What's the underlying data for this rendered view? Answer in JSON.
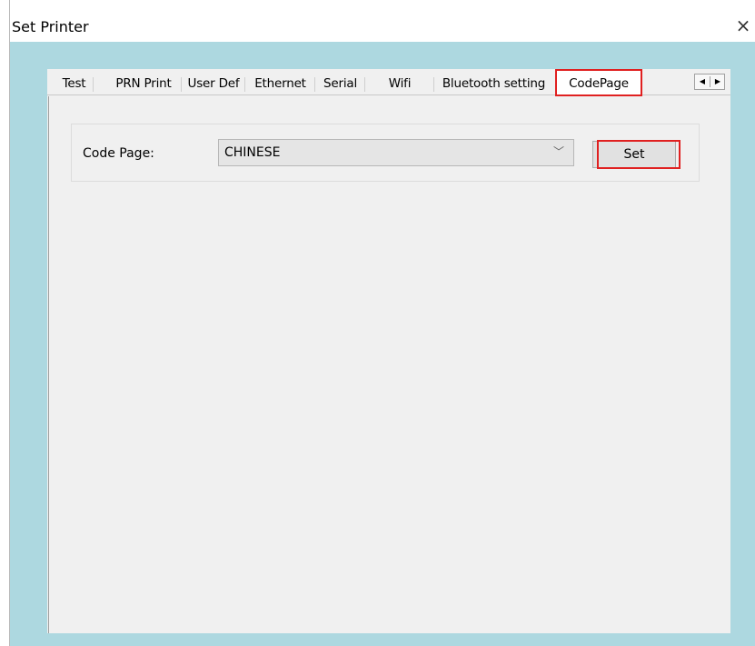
{
  "window": {
    "title": "Set Printer",
    "close_symbol": "×"
  },
  "tabs": [
    {
      "label": "Test"
    },
    {
      "label": "PRN Print"
    },
    {
      "label": "User Def"
    },
    {
      "label": "Ethernet"
    },
    {
      "label": "Serial"
    },
    {
      "label": "Wifi"
    },
    {
      "label": "Bluetooth setting"
    },
    {
      "label": "CodePage",
      "active": true
    }
  ],
  "tab_scroll": {
    "left_icon": "arrow-left-icon",
    "right_icon": "arrow-right-icon",
    "left_symbol": "◀",
    "right_symbol": "▶"
  },
  "codepage": {
    "label": "Code Page:",
    "selected": "CHINESE",
    "dropdown_icon": "chevron-down-icon",
    "dropdown_symbol": "﹀",
    "set_label": "Set"
  },
  "colors": {
    "client_background": "#add8e0",
    "dialog_background": "#f0f0f0",
    "highlight": "#e02020"
  }
}
